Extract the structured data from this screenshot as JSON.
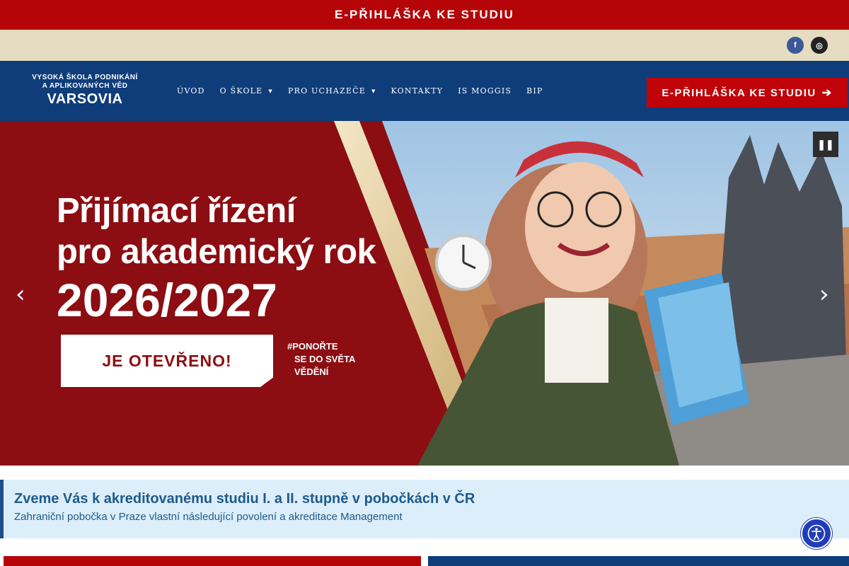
{
  "topbar": {
    "link": "E-PŘIHLÁŠKA KE STUDIU"
  },
  "social": {
    "facebook_glyph": "f",
    "instagram_glyph": "◎",
    "icons": [
      "facebook-icon",
      "instagram-icon"
    ]
  },
  "logo": {
    "line1": "VYSOKÁ ŠKOLA PODNIKÁNÍ",
    "line2": "A APLIKOVANÝCH VĚD",
    "line3": "VARSOVIA"
  },
  "nav": {
    "items": [
      {
        "label": "ÚVOD",
        "has_dropdown": false
      },
      {
        "label": "O ŠKOLE",
        "has_dropdown": true
      },
      {
        "label": "PRO UCHAZEČE",
        "has_dropdown": true
      },
      {
        "label": "KONTAKTY",
        "has_dropdown": false
      },
      {
        "label": "IS MOGGIS",
        "has_dropdown": false
      },
      {
        "label": "BIP",
        "has_dropdown": false
      }
    ],
    "caret": "▼"
  },
  "cta": {
    "label": "E-PŘIHLÁŠKA KE STUDIU",
    "arrow": "➔"
  },
  "hero": {
    "line1": "Přijímací řízení",
    "line2": "pro akademický rok",
    "year": "2026/2027",
    "badge": "JE OTEVŘENO!",
    "hashtag_1": "#PONOŘTE",
    "hashtag_2": "SE DO SVĚTA",
    "hashtag_3": "VĚDĚNÍ",
    "pause": "❚❚",
    "prev": "‹",
    "next": "›"
  },
  "info": {
    "title": "Zveme Vás k akreditovanému studiu I. a II. stupně v pobočkách v ČR",
    "text": "Zahraniční pobočka v Praze vlastní následující povolení a akreditace Management"
  },
  "colors": {
    "red": "#b50508",
    "navy": "#0f3d7a",
    "beige": "#e6dcc1",
    "info_bg": "#dceefa",
    "accent_blue": "#1f3cba"
  }
}
